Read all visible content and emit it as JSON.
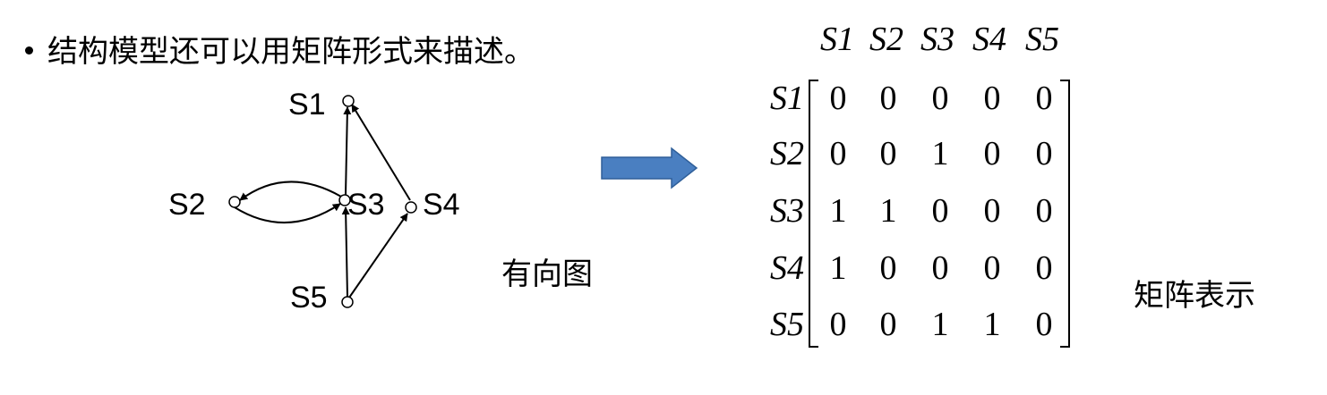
{
  "bullet_text": "结构模型还可以用矩阵形式来描述。",
  "graph": {
    "caption": "有向图",
    "nodes": [
      {
        "id": "S1",
        "label": "S1"
      },
      {
        "id": "S2",
        "label": "S2"
      },
      {
        "id": "S3",
        "label": "S3"
      },
      {
        "id": "S4",
        "label": "S4"
      },
      {
        "id": "S5",
        "label": "S5"
      }
    ],
    "edges": [
      {
        "from": "S3",
        "to": "S1"
      },
      {
        "from": "S4",
        "to": "S1"
      },
      {
        "from": "S3",
        "to": "S2"
      },
      {
        "from": "S2",
        "to": "S3"
      },
      {
        "from": "S5",
        "to": "S3"
      },
      {
        "from": "S5",
        "to": "S4"
      }
    ]
  },
  "arrow_color": "#4a7fc1",
  "matrix": {
    "caption": "矩阵表示",
    "col_headers": [
      "S1",
      "S2",
      "S3",
      "S4",
      "S5"
    ],
    "row_headers": [
      "S1",
      "S2",
      "S3",
      "S4",
      "S5"
    ],
    "rows": [
      [
        "0",
        "0",
        "0",
        "0",
        "0"
      ],
      [
        "0",
        "0",
        "1",
        "0",
        "0"
      ],
      [
        "1",
        "1",
        "0",
        "0",
        "0"
      ],
      [
        "1",
        "0",
        "0",
        "0",
        "0"
      ],
      [
        "0",
        "0",
        "1",
        "1",
        "0"
      ]
    ]
  }
}
